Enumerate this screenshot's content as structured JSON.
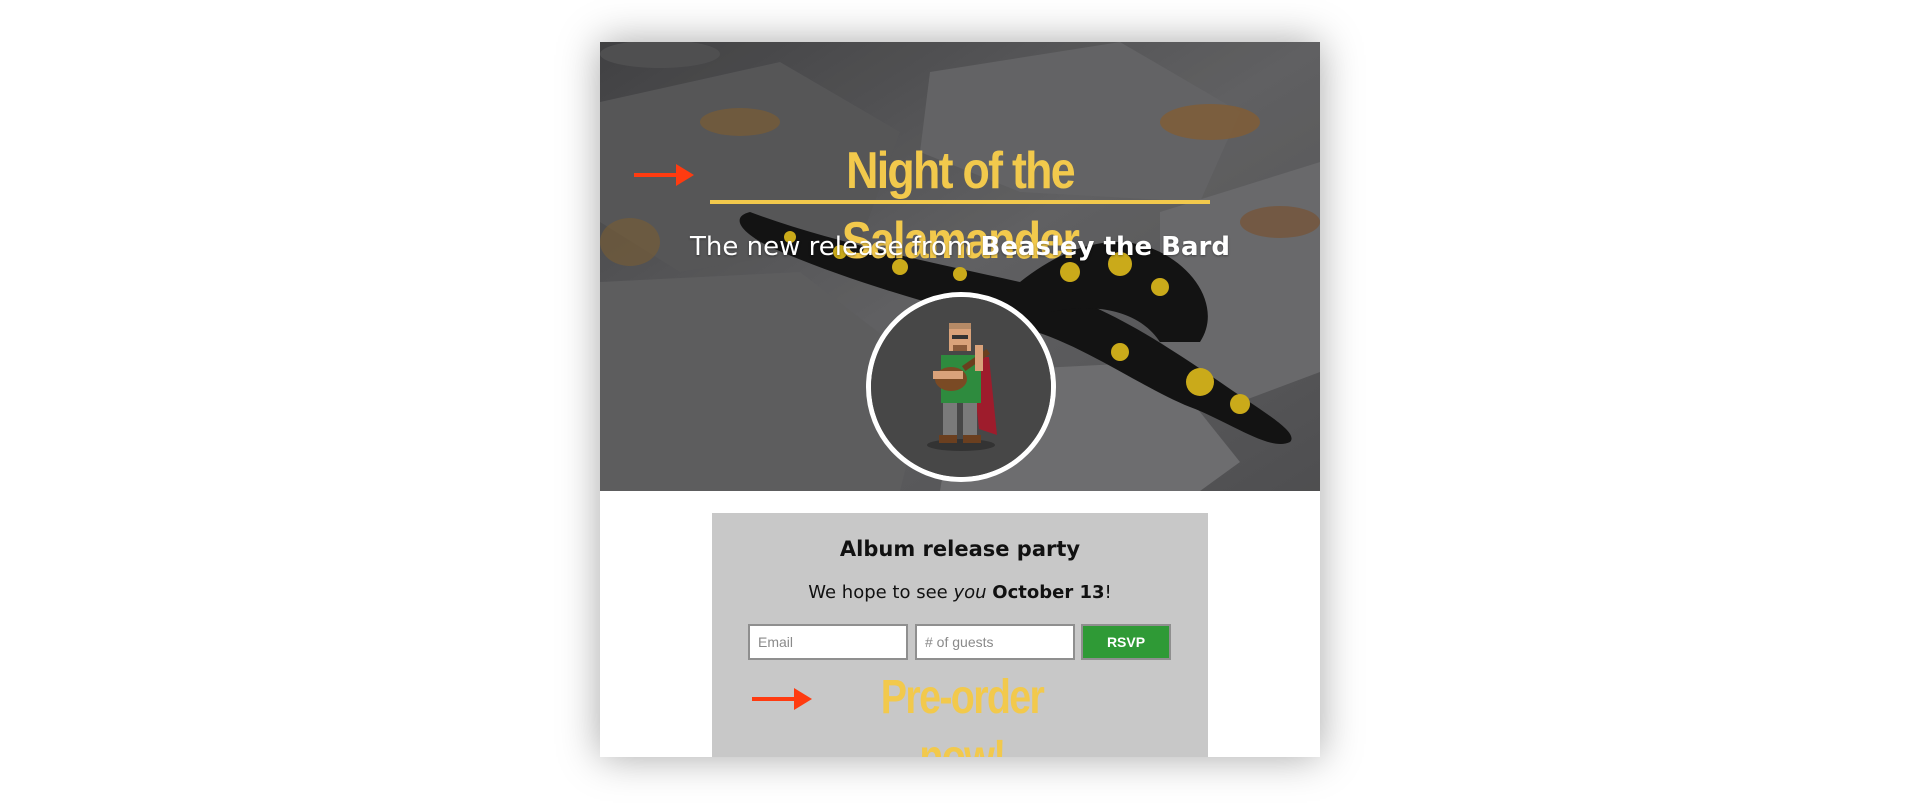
{
  "hero": {
    "title": "Night of the Salamander",
    "subtitle_prefix": "The new release from ",
    "subtitle_artist": "Beasley the Bard",
    "background_image": "salamander-on-rocks-photo",
    "avatar_image": "pixel-art-bard-with-lute",
    "arrow_icon": "right-arrow-icon"
  },
  "party": {
    "title": "Album release party",
    "text_prefix": "We hope to see ",
    "text_emphasis": "you",
    "text_date": "October 13",
    "text_suffix": "!",
    "email_placeholder": "Email",
    "guests_placeholder": "# of guests",
    "rsvp_label": "RSVP",
    "preorder_label": "Pre-order now!"
  },
  "colors": {
    "title_yellow": "#f2c94c",
    "arrow_red": "#ff3b10",
    "rsvp_green": "#2f9a36",
    "panel_gray": "#c8c8c8"
  }
}
